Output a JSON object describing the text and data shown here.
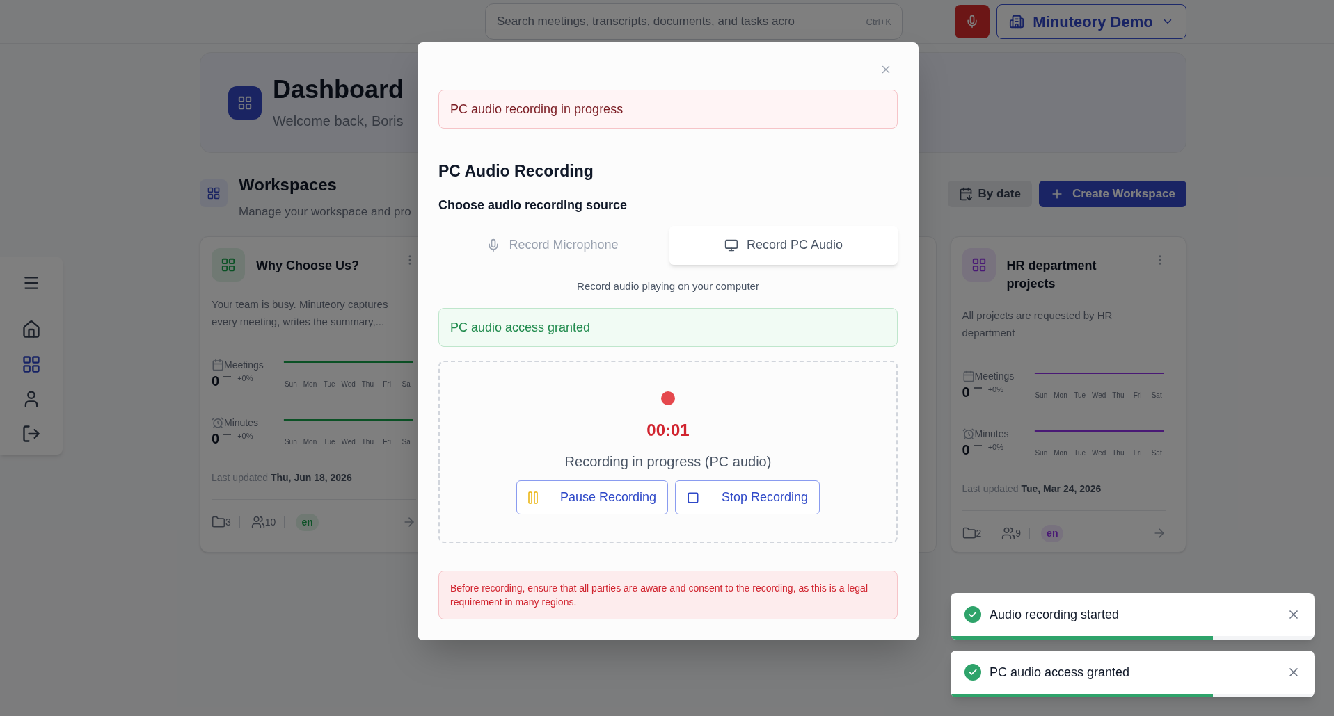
{
  "search": {
    "placeholder": "Search meetings, transcripts, documents, and tasks acro",
    "shortcut": "Ctrl+K"
  },
  "workspace_switcher": {
    "label": "Minuteory Demo"
  },
  "sidebar": {
    "items": [
      {
        "kind": "home",
        "selected": false
      },
      {
        "kind": "grid",
        "selected": true
      },
      {
        "kind": "user",
        "selected": false
      },
      {
        "kind": "logout",
        "selected": false
      }
    ]
  },
  "header": {
    "title": "Dashboard",
    "subtitle": "Welcome back, Boris"
  },
  "workspaces": {
    "title": "Workspaces",
    "subtitle": "Manage your workspace and pro",
    "sort_button": "By date",
    "create_button": "Create Workspace",
    "cards": [
      {
        "title": "Why Choose Us?",
        "description": "Your team is busy. Minuteory captures every meeting, writes the summary,...",
        "kind": "green",
        "stats": [
          {
            "kind": "meetings",
            "label": "Meetings",
            "value": "0",
            "change": "+0%",
            "days": [
              "Sun",
              "Mon",
              "Tue",
              "Wed",
              "Thu",
              "Fri",
              "Sa"
            ]
          },
          {
            "kind": "minutes",
            "label": "Minutes",
            "value": "0",
            "change": "+0%",
            "days": [
              "Sun",
              "Mon",
              "Tue",
              "Wed",
              "Thu",
              "Fri",
              "Sa"
            ]
          }
        ],
        "last_updated_label": "Last updated",
        "last_updated": "Thu, Jun 18, 2026",
        "folders": "3",
        "members": "10",
        "language": "en"
      },
      {
        "title": "HR department projects",
        "description": "All projects are requested by HR department",
        "kind": "purple",
        "stats": [
          {
            "kind": "meetings",
            "label": "Meetings",
            "value": "0",
            "change": "+0%",
            "days": [
              "Sun",
              "Mon",
              "Tue",
              "Wed",
              "Thu",
              "Fri",
              "Sat"
            ]
          },
          {
            "kind": "minutes",
            "label": "Minutes",
            "value": "0",
            "change": "+0%",
            "days": [
              "Sun",
              "Mon",
              "Tue",
              "Wed",
              "Thu",
              "Fri",
              "Sat"
            ]
          }
        ],
        "last_updated_label": "Last updated",
        "last_updated": "Tue, Mar 24, 2026",
        "folders": "2",
        "members": "9",
        "language": "en"
      }
    ]
  },
  "modal": {
    "alert": "PC audio recording in progress",
    "title": "PC Audio Recording",
    "source_label": "Choose audio recording source",
    "sources": [
      {
        "kind": "microphone",
        "label": "Record Microphone",
        "selected": false
      },
      {
        "kind": "pc",
        "label": "Record PC Audio",
        "selected": true
      }
    ],
    "source_hint": "Record audio playing on your computer",
    "access_status": "PC audio access granted",
    "recording": {
      "timer": "00:01",
      "status": "Recording in progress (PC audio)",
      "buttons": [
        {
          "kind": "pause",
          "label": "Pause Recording"
        },
        {
          "kind": "stop",
          "label": "Stop Recording"
        }
      ]
    },
    "consent_notice": "Before recording, ensure that all parties are aware and consent to the recording, as this is a legal requirement in many regions."
  },
  "toasts": [
    {
      "message": "Audio recording started",
      "level": 0.72
    },
    {
      "message": "PC audio access granted",
      "level": 0.72
    }
  ]
}
